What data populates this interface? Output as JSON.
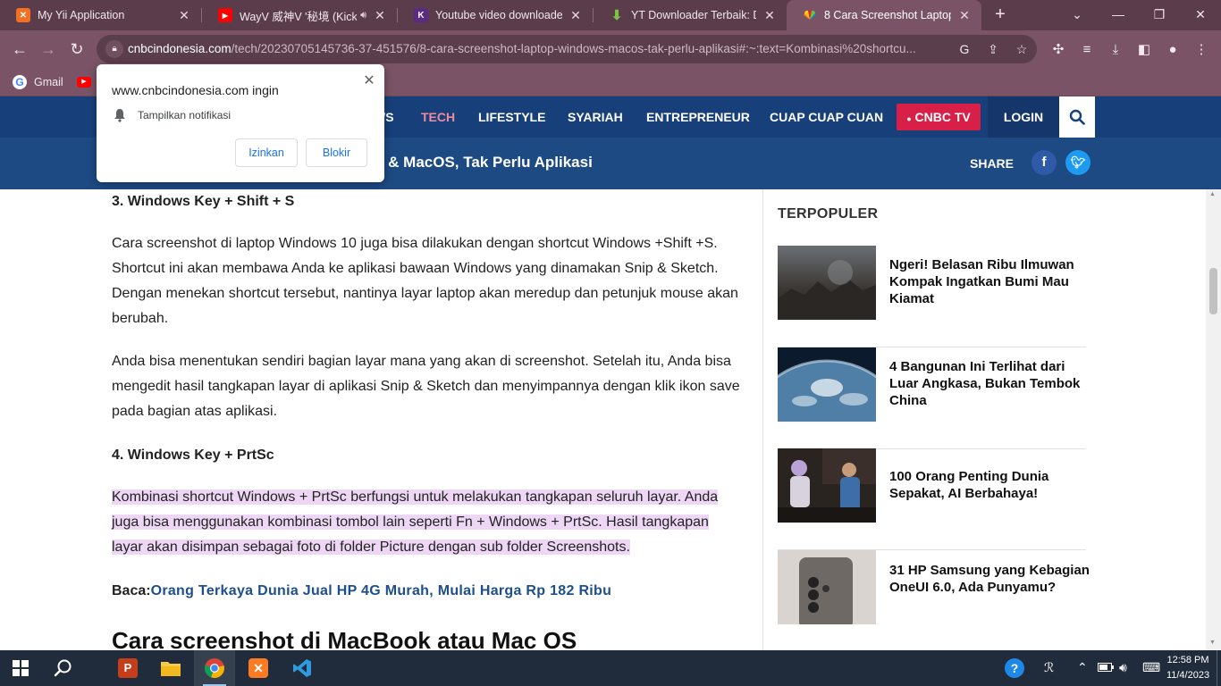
{
  "browser": {
    "tabs": [
      {
        "title": "My Yii Application",
        "icon": "xampp-icon"
      },
      {
        "title": "WayV 威神V '秘境 (Kick",
        "icon": "youtube-icon"
      },
      {
        "title": "Youtube video downloader o",
        "icon": "kv-icon"
      },
      {
        "title": "YT Downloader Terbaik: Dow",
        "icon": "download-arrow-icon"
      },
      {
        "title": "8 Cara Screenshot Laptop W",
        "icon": "cnbc-icon"
      }
    ],
    "new_tab": "+",
    "url_host": "cnbcindonesia.com",
    "url_path": "/tech/20230705145736-37-451576/8-cara-screenshot-laptop-windows-macos-tak-perlu-aplikasi#:~:text=Kombinasi%20shortcu...",
    "bookmarks": [
      {
        "label": "Gmail"
      }
    ]
  },
  "site": {
    "nav": [
      "WS",
      "TECH",
      "LIFESTYLE",
      "SYARIAH",
      "ENTREPRENEUR",
      "CUAP CUAP CUAN"
    ],
    "cnbc_tv": "CNBC TV",
    "login": "LOGIN",
    "sticky_title": "s & MacOS, Tak Perlu Aplikasi",
    "share": "SHARE"
  },
  "article": {
    "h3_windows_shift_s": "3. Windows Key + Shift + S",
    "p1": "Cara screenshot di laptop Windows 10 juga bisa dilakukan dengan shortcut Windows +Shift +S. Shortcut ini akan membawa Anda ke aplikasi bawaan Windows yang dinamakan Snip & Sketch. Dengan menekan shortcut tersebut, nantinya layar laptop akan meredup dan petunjuk mouse akan berubah.",
    "p2": "Anda bisa menentukan sendiri bagian layar mana yang akan di screenshot. Setelah itu, Anda bisa mengedit hasil tangkapan layar di aplikasi Snip & Sketch dan menyimpannya dengan klik ikon save pada bagian atas aplikasi.",
    "h3_prtsc": "4. Windows Key + PrtSc",
    "p3_highlighted": "Kombinasi shortcut Windows + PrtSc berfungsi untuk melakukan tangkapan seluruh layar. Anda juga bisa menggunakan kombinasi tombol lain seperti Fn + Windows + PrtSc. Hasil tangkapan layar akan disimpan sebagai foto di folder Picture dengan sub folder Screenshots.",
    "baca_label": "Baca:",
    "baca_link": "Orang Terkaya Dunia Jual HP 4G Murah, Mulai Harga Rp 182 Ribu",
    "h2": "Cara screenshot di MacBook atau Mac OS"
  },
  "sidebar": {
    "heading": "TERPOPULER",
    "items": [
      {
        "title": "Ngeri! Belasan Ribu Ilmuwan Kompak Ingatkan Bumi Mau Kiamat"
      },
      {
        "title": "4 Bangunan Ini Terlihat dari Luar Angkasa, Bukan Tembok China"
      },
      {
        "title": "100 Orang Penting Dunia Sepakat, AI Berbahaya!"
      },
      {
        "title": "31 HP Samsung yang Kebagian OneUI 6.0, Ada Punyamu?"
      }
    ]
  },
  "popup": {
    "title": "www.cnbcindonesia.com ingin",
    "permission": "Tampilkan notifikasi",
    "allow": "Izinkan",
    "block": "Blokir"
  },
  "taskbar": {
    "time": "12:58 PM",
    "date": "11/4/2023"
  },
  "colors": {
    "chrome_dark": "#5a3c4b",
    "chrome_light": "#7a5466",
    "site_nav": "#17407a",
    "highlight": "#eed7f5",
    "cnbc_tv_red": "#d81f47",
    "link_blue": "#1d4f8c"
  }
}
